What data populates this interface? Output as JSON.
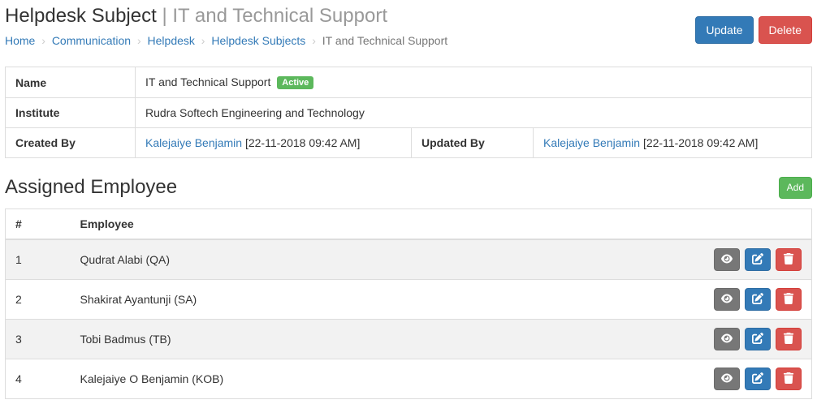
{
  "header": {
    "title_prefix": "Helpdesk Subject",
    "title_sep": " | ",
    "title_name": "IT and Technical Support"
  },
  "breadcrumb": {
    "items": [
      {
        "label": "Home",
        "link": true
      },
      {
        "label": "Communication",
        "link": true
      },
      {
        "label": "Helpdesk",
        "link": true
      },
      {
        "label": "Helpdesk Subjects",
        "link": true
      },
      {
        "label": "IT and Technical Support",
        "link": false
      }
    ],
    "sep": "›"
  },
  "actions": {
    "update_label": "Update",
    "delete_label": "Delete"
  },
  "details": {
    "name_label": "Name",
    "name_value": "IT and Technical Support",
    "name_badge": "Active",
    "institute_label": "Institute",
    "institute_value": "Rudra Softech Engineering and Technology",
    "created_by_label": "Created By",
    "created_by_user": "Kalejaiye Benjamin",
    "created_by_ts": " [22-11-2018 09:42 AM]",
    "updated_by_label": "Updated By",
    "updated_by_user": "Kalejaiye Benjamin",
    "updated_by_ts": " [22-11-2018 09:42 AM]"
  },
  "assigned": {
    "heading": "Assigned Employee",
    "add_label": "Add",
    "col_index": "#",
    "col_employee": "Employee",
    "rows": [
      {
        "idx": "1",
        "name": "Qudrat Alabi (QA)"
      },
      {
        "idx": "2",
        "name": "Shakirat Ayantunji (SA)"
      },
      {
        "idx": "3",
        "name": "Tobi Badmus (TB)"
      },
      {
        "idx": "4",
        "name": "Kalejaiye O Benjamin (KOB)"
      }
    ]
  },
  "icons": {
    "view": "eye-icon",
    "edit": "edit-icon",
    "delete": "trash-icon"
  }
}
